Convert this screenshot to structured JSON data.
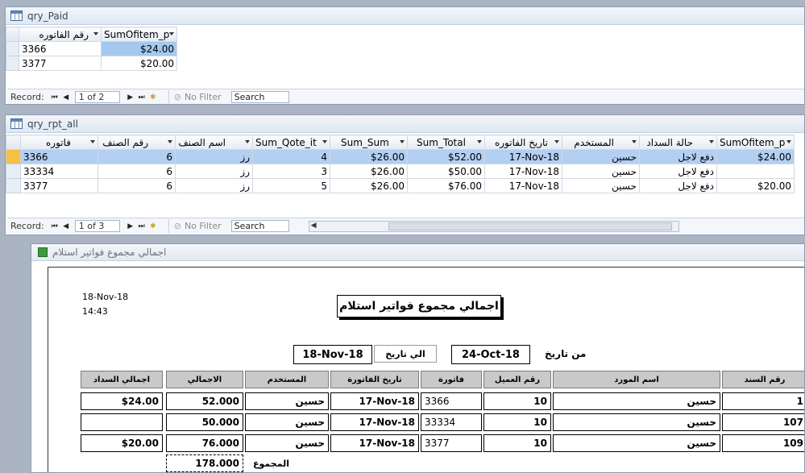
{
  "qry_paid": {
    "title": "qry_Paid",
    "columns": [
      "رقم الفاتوره",
      "SumOfitem_p"
    ],
    "rows": [
      {
        "invoice": "3366",
        "sum": "$24.00"
      },
      {
        "invoice": "3377",
        "sum": "$20.00"
      }
    ],
    "nav": {
      "record_label": "Record:",
      "position": "1 of 2",
      "filter": "No Filter",
      "search": "Search"
    }
  },
  "qry_rpt_all": {
    "title": "qry_rpt_all",
    "columns": [
      "فاتوره",
      "رقم الصنف",
      "اسم الصنف",
      "Sum_Qote_it",
      "Sum_Sum",
      "Sum_Total",
      "تاريخ الفاتوره",
      "المستخدم",
      "حالة السداد",
      "SumOfitem_p"
    ],
    "rows": [
      {
        "c0": "3366",
        "c1": "6",
        "c2": "رز",
        "c3": "4",
        "c4": "$26.00",
        "c5": "$52.00",
        "c6": "17-Nov-18",
        "c7": "حسين",
        "c8": "دفع لاجل",
        "c9": "$24.00"
      },
      {
        "c0": "33334",
        "c1": "6",
        "c2": "رز",
        "c3": "3",
        "c4": "$26.00",
        "c5": "$50.00",
        "c6": "17-Nov-18",
        "c7": "حسين",
        "c8": "دفع لاجل",
        "c9": ""
      },
      {
        "c0": "3377",
        "c1": "6",
        "c2": "رز",
        "c3": "5",
        "c4": "$26.00",
        "c5": "$76.00",
        "c6": "17-Nov-18",
        "c7": "حسين",
        "c8": "دفع لاجل",
        "c9": "$20.00"
      }
    ],
    "nav": {
      "record_label": "Record:",
      "position": "1 of 3",
      "filter": "No Filter",
      "search": "Search"
    }
  },
  "report": {
    "window_title": "اجمالي مجموع فواتير استلام",
    "print_date": "18-Nov-18",
    "print_time": "14:43",
    "heading": "اجمالي مجموع فواتير استلام",
    "from_label": "من تاريخ",
    "from_value": "24-Oct-18",
    "to_label": "الي تاريخ",
    "to_value": "18-Nov-18",
    "headers": {
      "doc_no": "رقم السند",
      "supplier": "اسم المورد",
      "client_no": "رقم العميل",
      "invoice": "فاتورة",
      "invoice_date": "تاريخ الفاتورة",
      "user": "المستخدم",
      "total": "الاجمالي",
      "paid_total": "اجمالي السداد"
    },
    "rows": [
      {
        "doc_no": "1",
        "supplier": "حسين",
        "client_no": "10",
        "invoice": "3366",
        "invoice_date": "17-Nov-18",
        "user": "حسين",
        "total": "52.000",
        "paid_total": "$24.00"
      },
      {
        "doc_no": "107",
        "supplier": "حسين",
        "client_no": "10",
        "invoice": "33334",
        "invoice_date": "17-Nov-18",
        "user": "حسين",
        "total": "50.000",
        "paid_total": ""
      },
      {
        "doc_no": "109",
        "supplier": "حسين",
        "client_no": "10",
        "invoice": "3377",
        "invoice_date": "17-Nov-18",
        "user": "حسين",
        "total": "76.000",
        "paid_total": "$20.00"
      }
    ],
    "sum_label": "المجموع",
    "sum_value": "178.000"
  }
}
